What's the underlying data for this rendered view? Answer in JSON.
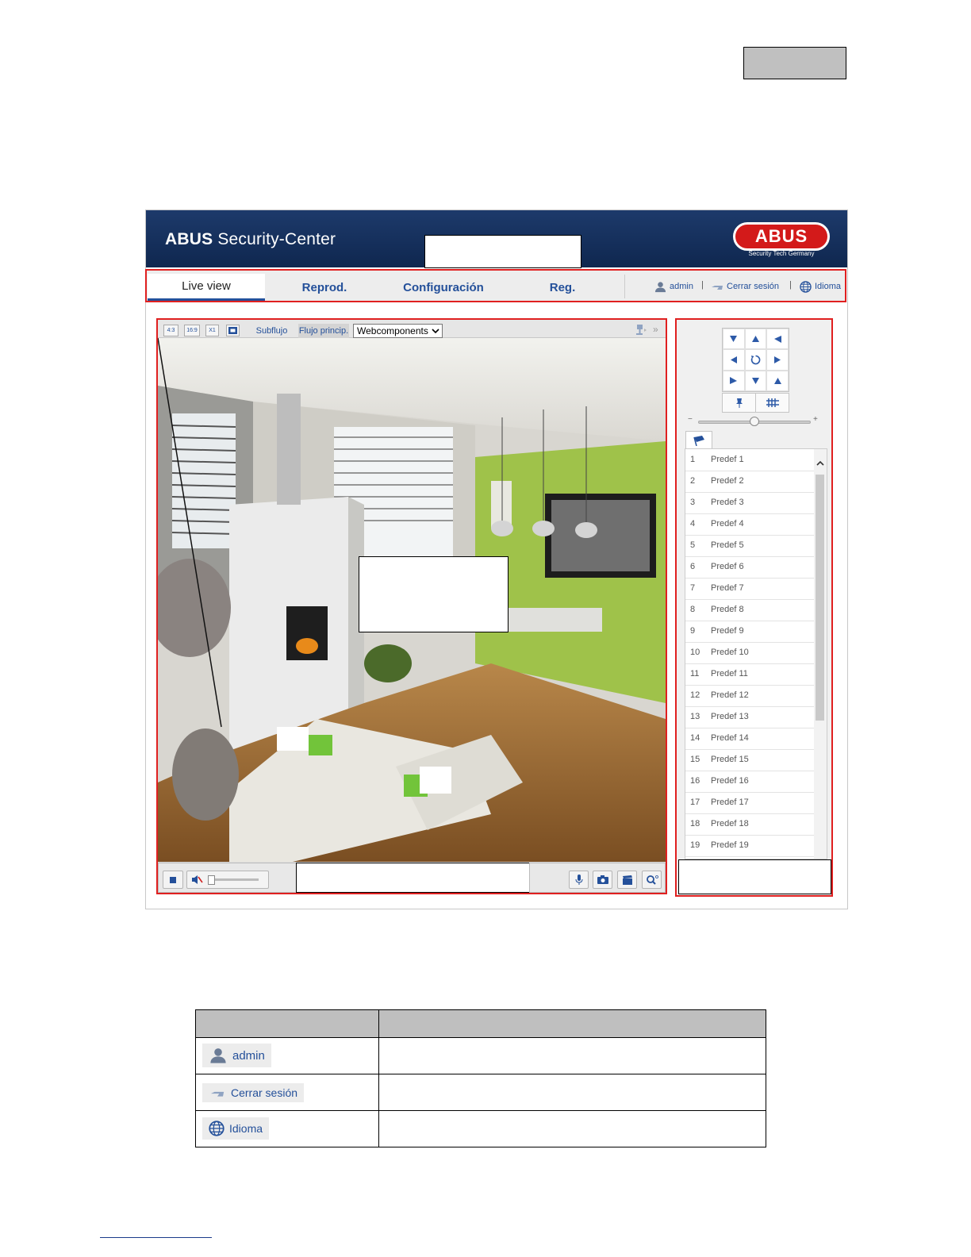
{
  "header": {
    "brand_prefix": "ABUS",
    "brand_suffix": " Security-Center",
    "logo_text": "ABUS",
    "logo_tagline": "Security Tech Germany"
  },
  "nav": {
    "tabs": [
      {
        "label": "Live view"
      },
      {
        "label": "Reprod."
      },
      {
        "label": "Configuración"
      },
      {
        "label": "Reg."
      }
    ],
    "user_label": "admin",
    "logout_label": "Cerrar sesión",
    "language_label": "Idioma",
    "separator": "|"
  },
  "video_toolbar": {
    "ratio_4_3": "4:3",
    "ratio_16_9": "16:9",
    "ratio_x1": "X1",
    "substream_label": "Subflujo",
    "mainstream_label": "Flujo princip.",
    "plugin_select_value": "Webcomponents",
    "expand_label": "»"
  },
  "ptz": {
    "zoom_minus": "−",
    "zoom_plus": "+",
    "presets": [
      {
        "num": "1",
        "name": "Predef 1"
      },
      {
        "num": "2",
        "name": "Predef 2"
      },
      {
        "num": "3",
        "name": "Predef 3"
      },
      {
        "num": "4",
        "name": "Predef 4"
      },
      {
        "num": "5",
        "name": "Predef 5"
      },
      {
        "num": "6",
        "name": "Predef 6"
      },
      {
        "num": "7",
        "name": "Predef 7"
      },
      {
        "num": "8",
        "name": "Predef 8"
      },
      {
        "num": "9",
        "name": "Predef 9"
      },
      {
        "num": "10",
        "name": "Predef 10"
      },
      {
        "num": "11",
        "name": "Predef 11"
      },
      {
        "num": "12",
        "name": "Predef 12"
      },
      {
        "num": "13",
        "name": "Predef 13"
      },
      {
        "num": "14",
        "name": "Predef 14"
      },
      {
        "num": "15",
        "name": "Predef 15"
      },
      {
        "num": "16",
        "name": "Predef 16"
      },
      {
        "num": "17",
        "name": "Predef 17"
      },
      {
        "num": "18",
        "name": "Predef 18"
      },
      {
        "num": "19",
        "name": "Predef 19"
      }
    ]
  },
  "legend_table": {
    "rows": [
      {
        "label": "admin",
        "icon": "user-icon"
      },
      {
        "label": "Cerrar sesión",
        "icon": "logout-icon"
      },
      {
        "label": "Idioma",
        "icon": "globe-icon"
      }
    ]
  },
  "colors": {
    "brand_blue": "#0f274f",
    "link_blue": "#24509a",
    "highlight_red": "#e02020",
    "logo_red": "#d31a1a"
  }
}
